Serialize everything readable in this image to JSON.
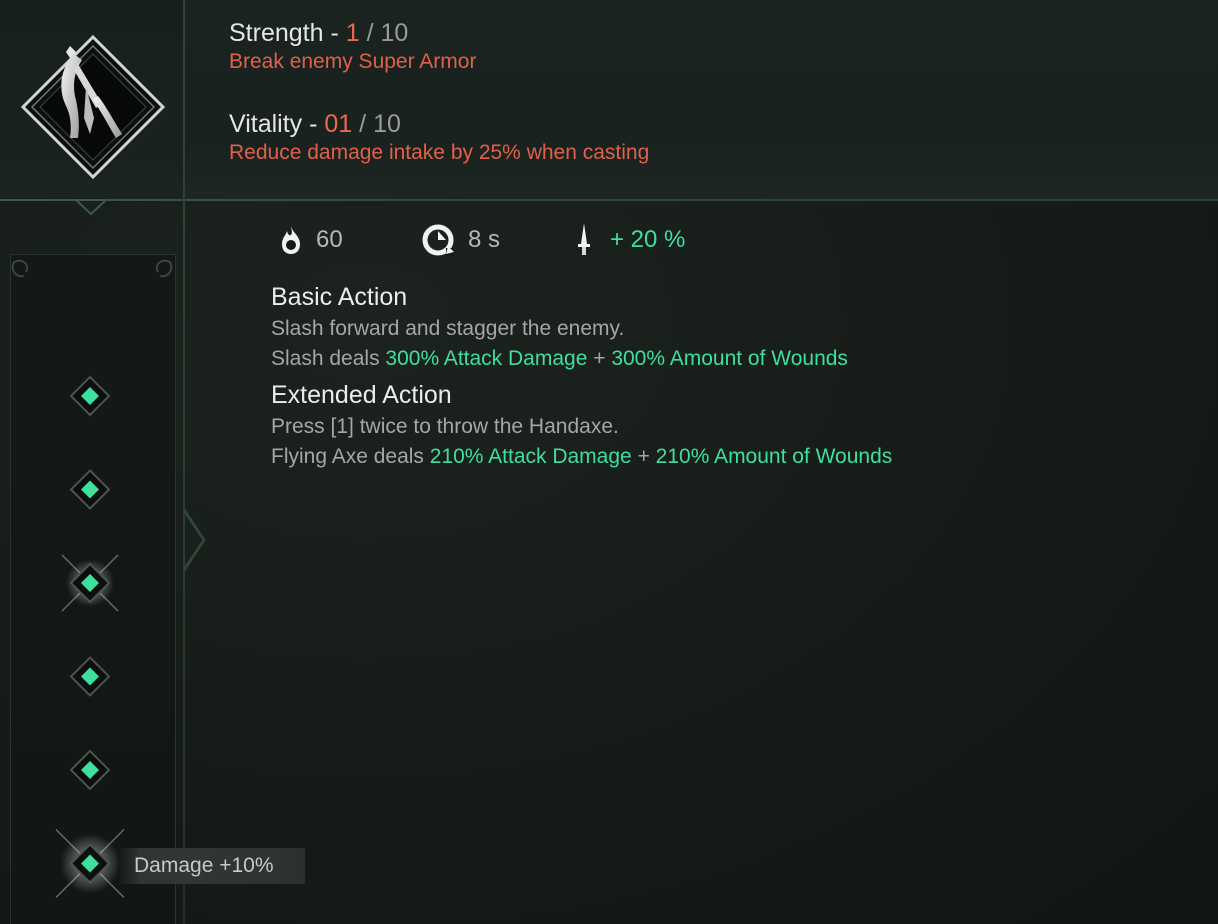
{
  "skill": {
    "icon": "scythe-axe-skill-icon",
    "strength": {
      "label": "Strength -",
      "current": "1",
      "max": "/ 10",
      "effect": "Break enemy Super Armor"
    },
    "vitality": {
      "label": "Vitality -",
      "current": "01",
      "max": "/ 10",
      "effect": "Reduce damage intake by 25% when casting"
    }
  },
  "stats": {
    "mana_icon": "flame-icon",
    "mana": "60",
    "cooldown_icon": "cooldown-clock-icon",
    "cooldown": "8 s",
    "damage_icon": "dagger-icon",
    "damage_bonus": "+ 20 %"
  },
  "description": {
    "basic_title": "Basic Action",
    "basic_line1": "Slash forward and stagger the enemy.",
    "basic_line2_prefix": "Slash deals",
    "basic_line2_a": "300% Attack Damage",
    "basic_line2_plus": "+",
    "basic_line2_b": "300% Amount of Wounds",
    "extended_title": "Extended Action",
    "extended_line1": "Press [1] twice to throw the Handaxe.",
    "extended_line2_prefix": "Flying Axe deals",
    "extended_line2_a": "210% Attack Damage",
    "extended_line2_plus": "+",
    "extended_line2_b": "210% Amount of Wounds"
  },
  "tree": {
    "node_count": 6,
    "tooltip": "Damage +10%"
  },
  "colors": {
    "accent_green": "#3fdf9d",
    "accent_red": "#e0604a",
    "background": "#151a17"
  }
}
